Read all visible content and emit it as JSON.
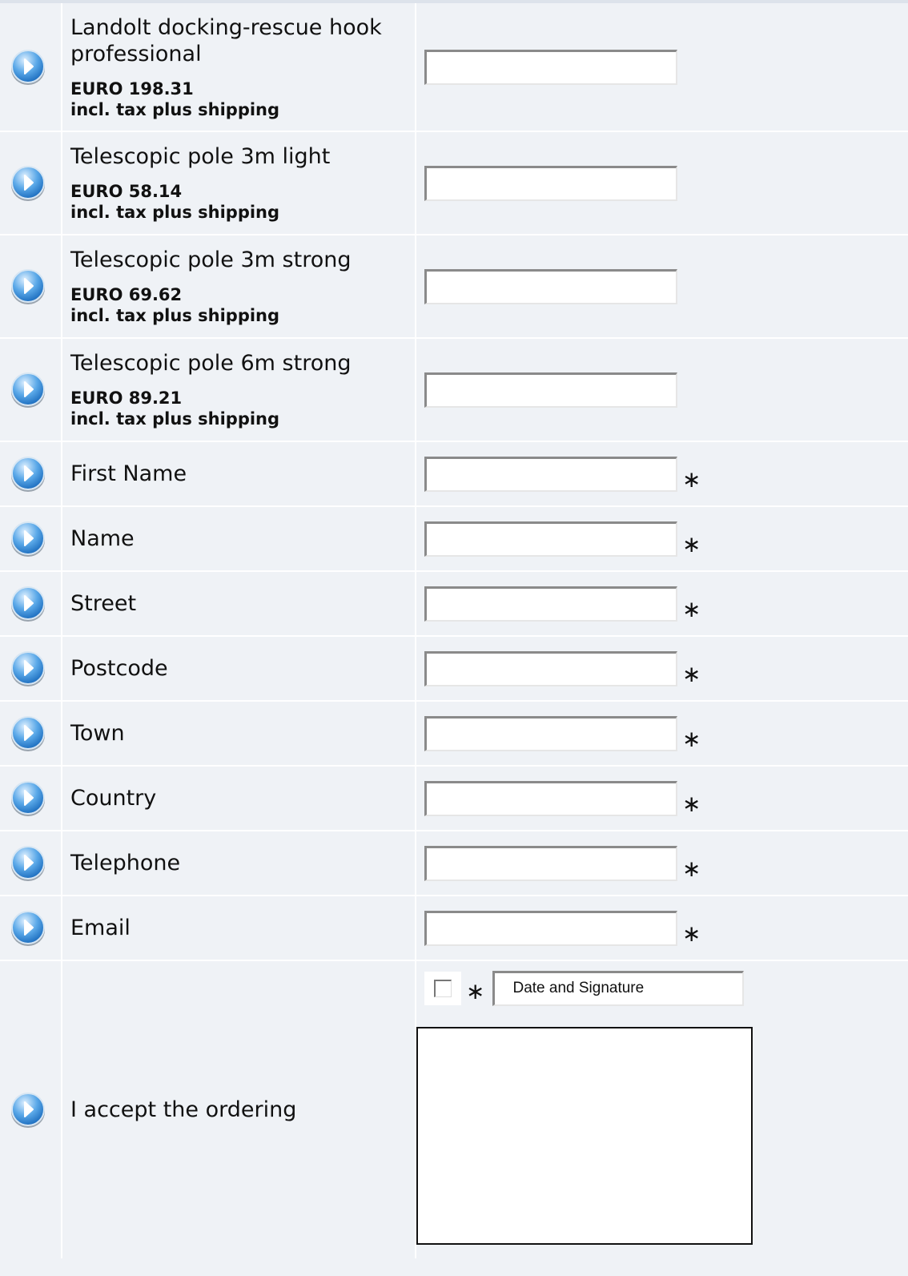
{
  "products": [
    {
      "name": "Landolt docking-rescue hook professional",
      "price": "EURO 198.31",
      "price_note": "incl. tax plus shipping",
      "quantity": ""
    },
    {
      "name": "Telescopic pole 3m light",
      "price": "EURO 58.14",
      "price_note": "incl. tax plus shipping",
      "quantity": ""
    },
    {
      "name": "Telescopic pole 3m strong",
      "price": "EURO 69.62",
      "price_note": "incl. tax plus shipping",
      "quantity": ""
    },
    {
      "name": "Telescopic pole 6m strong",
      "price": "EURO 89.21",
      "price_note": "incl. tax plus shipping",
      "quantity": ""
    }
  ],
  "fields": [
    {
      "label": "First Name",
      "value": "",
      "required_mark": "∗"
    },
    {
      "label": "Name",
      "value": "",
      "required_mark": "∗"
    },
    {
      "label": "Street",
      "value": "",
      "required_mark": "∗"
    },
    {
      "label": "Postcode",
      "value": "",
      "required_mark": "∗"
    },
    {
      "label": "Town",
      "value": "",
      "required_mark": "∗"
    },
    {
      "label": "Country",
      "value": "",
      "required_mark": "∗"
    },
    {
      "label": "Telephone",
      "value": "",
      "required_mark": "∗"
    },
    {
      "label": "Email",
      "value": "",
      "required_mark": "∗"
    }
  ],
  "accept": {
    "label": "I accept the ordering",
    "required_mark": "∗",
    "date_signature_text": "Date and Signature",
    "checked": false
  },
  "colors": {
    "background": "#eff2f6",
    "icon_blue": "#2f86d6"
  },
  "icon": "arrow-right-circle-icon"
}
